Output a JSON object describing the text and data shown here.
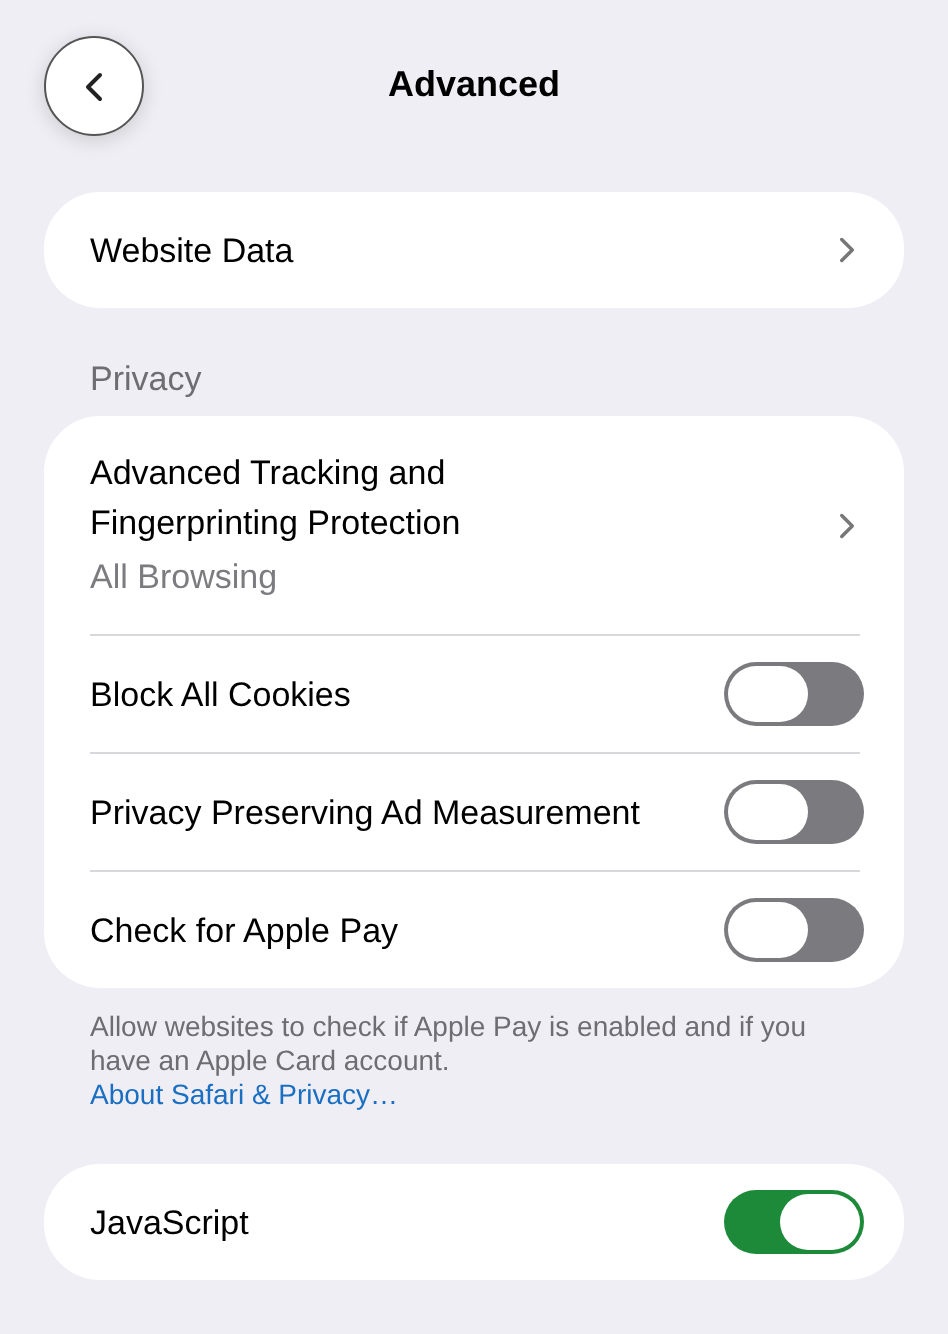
{
  "header": {
    "title": "Advanced"
  },
  "sections": [
    {
      "rows": [
        {
          "kind": "link",
          "label": "Website Data"
        }
      ]
    },
    {
      "header": "Privacy",
      "rows": [
        {
          "kind": "link",
          "label": "Advanced Tracking and Fingerprinting Protection",
          "detail": "All Browsing"
        },
        {
          "kind": "toggle",
          "label": "Block All Cookies",
          "on": false
        },
        {
          "kind": "toggle",
          "label": "Privacy Preserving Ad Measurement",
          "on": false
        },
        {
          "kind": "toggle",
          "label": "Check for Apple Pay",
          "on": false
        }
      ],
      "footer": {
        "text": "Allow websites to check if Apple Pay is enabled and if you have an Apple Card account.",
        "link": "About Safari & Privacy…"
      }
    },
    {
      "rows": [
        {
          "kind": "toggle",
          "label": "JavaScript",
          "on": true
        }
      ]
    }
  ]
}
